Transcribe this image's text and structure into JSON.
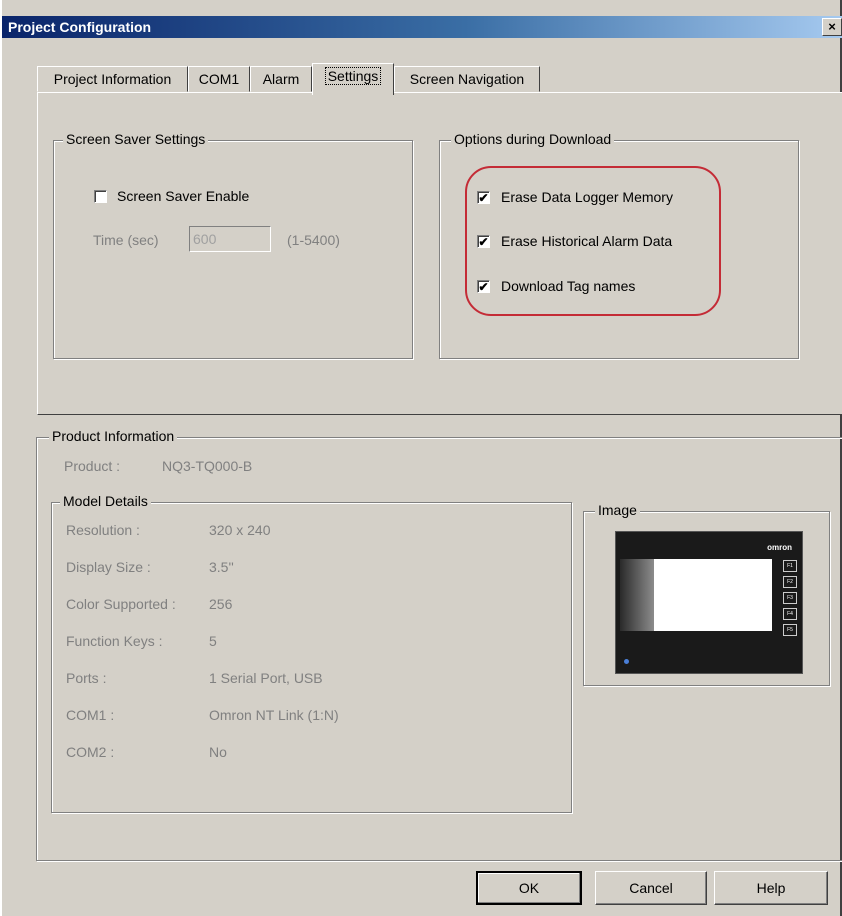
{
  "window": {
    "title": "Project Configuration",
    "close_label": "×"
  },
  "tabs": [
    {
      "label": "Project Information",
      "active": false
    },
    {
      "label": "COM1",
      "active": false
    },
    {
      "label": "Alarm",
      "active": false
    },
    {
      "label": "Settings",
      "active": true
    },
    {
      "label": "Screen Navigation",
      "active": false
    }
  ],
  "screen_saver": {
    "group_label": "Screen Saver Settings",
    "enable_label": "Screen Saver Enable",
    "enable_checked": false,
    "time_label": "Time (sec)",
    "time_value": "600",
    "range_label": "(1-5400)"
  },
  "download_options": {
    "group_label": "Options during Download",
    "items": [
      {
        "label": "Erase Data Logger Memory",
        "checked": true,
        "mark": "✔"
      },
      {
        "label": "Erase Historical Alarm Data",
        "checked": true,
        "mark": "✔"
      },
      {
        "label": "Download Tag names",
        "checked": true,
        "mark": "✔"
      }
    ],
    "highlight_color": "#c42b36"
  },
  "product_info": {
    "group_label": "Product Information",
    "product_label": "Product :",
    "product_value": "NQ3-TQ000-B",
    "model_details": {
      "group_label": "Model Details",
      "rows": [
        {
          "label": "Resolution :",
          "value": "320 x 240"
        },
        {
          "label": "Display Size :",
          "value": "3.5''"
        },
        {
          "label": "Color Supported :",
          "value": "256"
        },
        {
          "label": "Function Keys :",
          "value": "5"
        },
        {
          "label": "Ports :",
          "value": "1 Serial Port, USB"
        },
        {
          "label": "COM1 :",
          "value": "Omron NT Link (1:N)"
        },
        {
          "label": "COM2 :",
          "value": "No"
        }
      ]
    },
    "image": {
      "group_label": "Image",
      "brand_text": "omron",
      "function_keys": [
        "F1",
        "F2",
        "F3",
        "F4",
        "F5"
      ]
    }
  },
  "buttons": {
    "ok": "OK",
    "cancel": "Cancel",
    "help": "Help"
  }
}
